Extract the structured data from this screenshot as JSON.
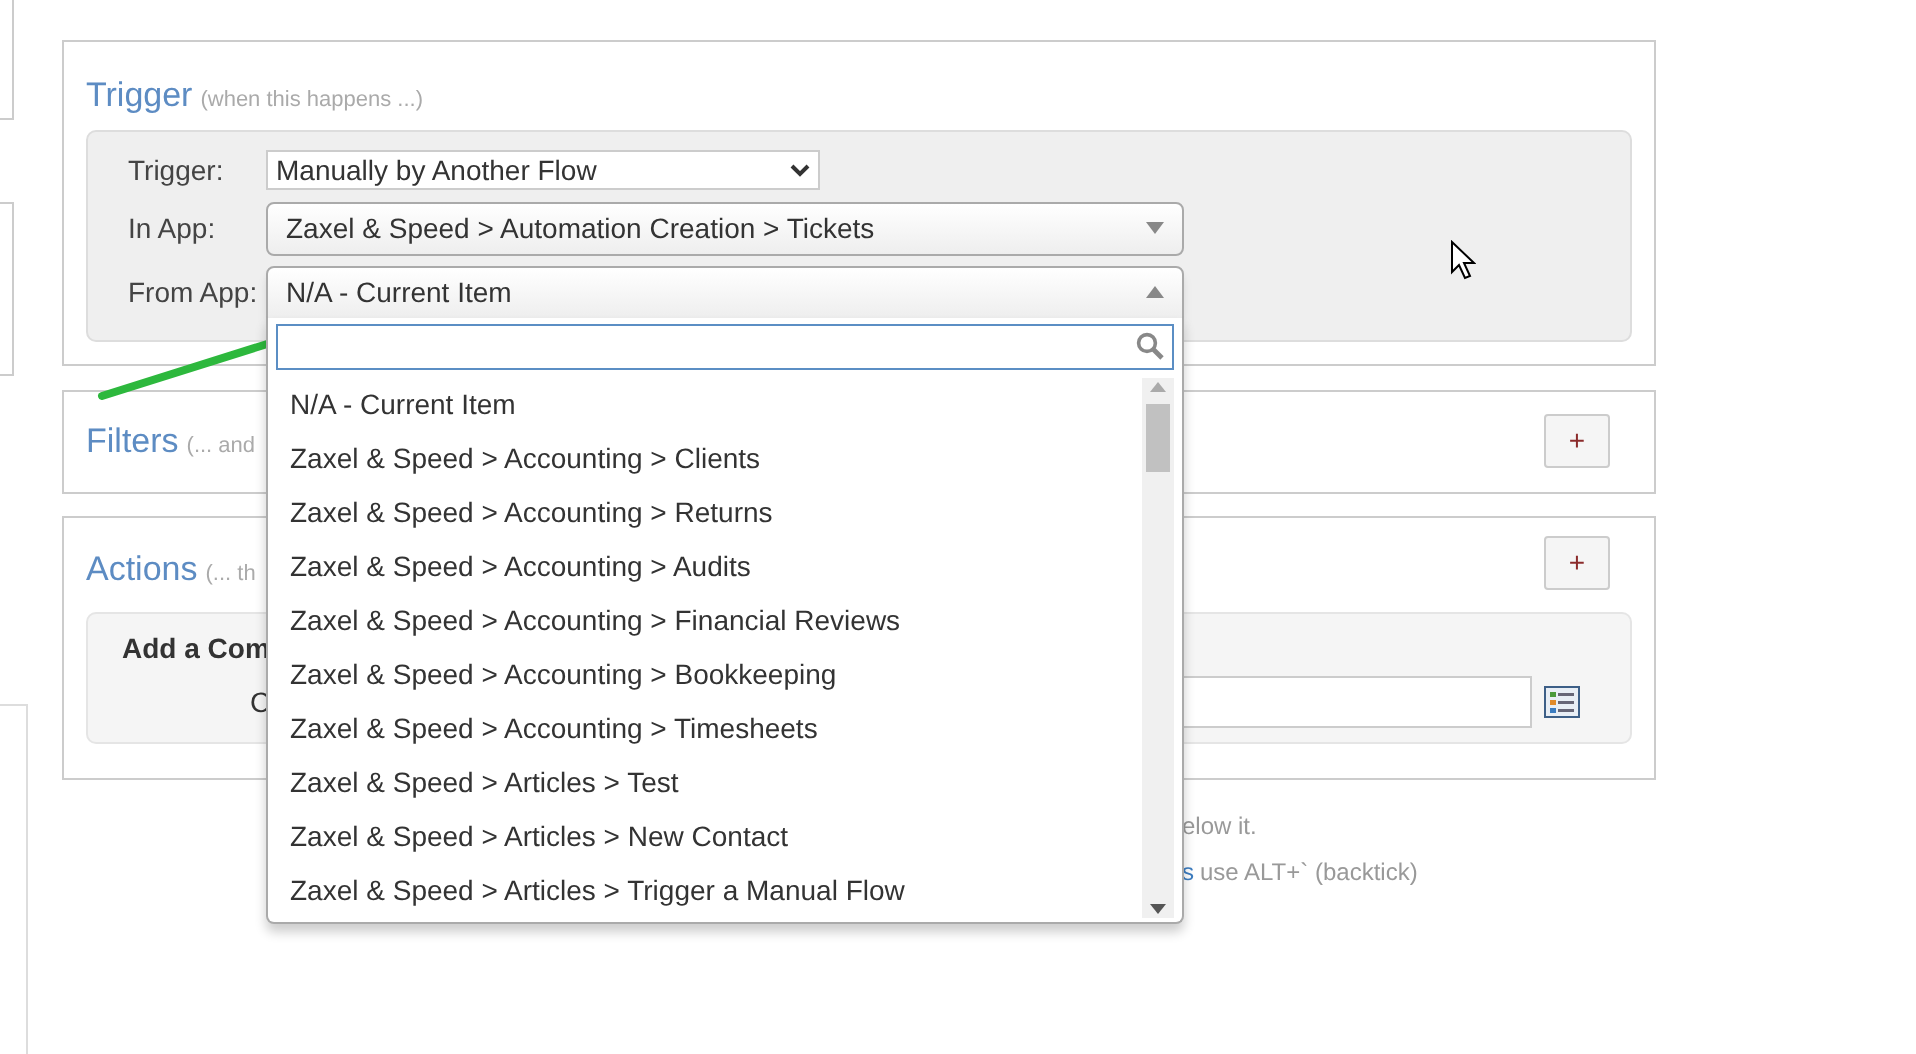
{
  "trigger": {
    "title": "Trigger",
    "subtitle": "(when this happens ...)",
    "fields": [
      {
        "label": "Trigger:",
        "value": "Manually by Another Flow",
        "kind": "native",
        "expanded": false
      },
      {
        "label": "In App:",
        "value": "Zaxel & Speed > Automation Creation > Tickets",
        "kind": "combo",
        "expanded": false
      },
      {
        "label": "From App:",
        "value": "N/A - Current Item",
        "kind": "combo",
        "expanded": true,
        "options": [
          "N/A - Current Item",
          "Zaxel & Speed > Accounting > Clients",
          "Zaxel & Speed > Accounting > Returns",
          "Zaxel & Speed > Accounting > Audits",
          "Zaxel & Speed > Accounting > Financial Reviews",
          "Zaxel & Speed > Accounting > Bookkeeping",
          "Zaxel & Speed > Accounting > Timesheets",
          "Zaxel & Speed > Articles > Test",
          "Zaxel & Speed > Articles > New Contact",
          "Zaxel & Speed > Articles > Trigger a Manual Flow"
        ]
      }
    ]
  },
  "filters": {
    "title": "Filters",
    "subtitle": "(... and",
    "add_button": "+"
  },
  "actions": {
    "title": "Actions",
    "subtitle": "(... th",
    "add_button": "+",
    "comment": {
      "heading": "Add a Com",
      "label": "C"
    }
  },
  "help": {
    "line_1": "elow it.",
    "link": "s",
    "line_2": "use ALT+` (backtick)"
  }
}
